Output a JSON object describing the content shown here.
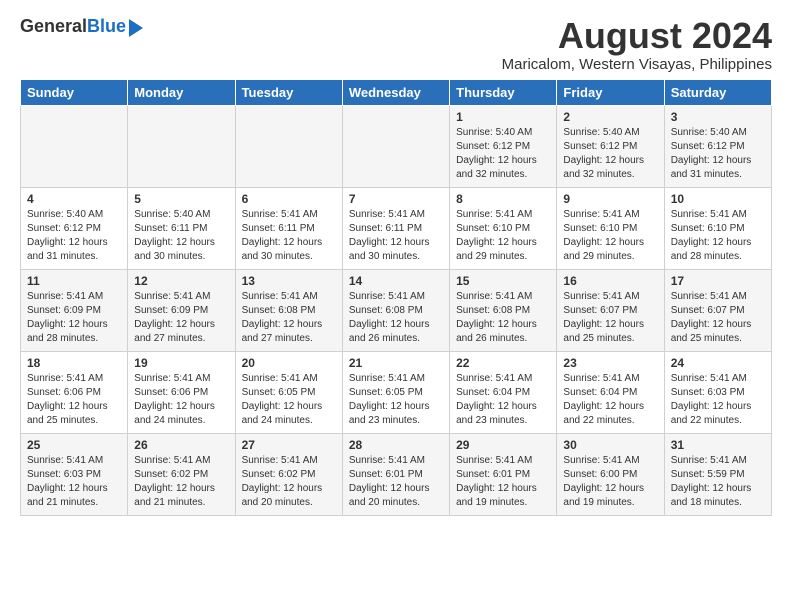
{
  "logo": {
    "general": "General",
    "blue": "Blue"
  },
  "title": {
    "month_year": "August 2024",
    "location": "Maricalom, Western Visayas, Philippines"
  },
  "headers": [
    "Sunday",
    "Monday",
    "Tuesday",
    "Wednesday",
    "Thursday",
    "Friday",
    "Saturday"
  ],
  "weeks": [
    [
      {
        "day": "",
        "sunrise": "",
        "sunset": "",
        "daylight": ""
      },
      {
        "day": "",
        "sunrise": "",
        "sunset": "",
        "daylight": ""
      },
      {
        "day": "",
        "sunrise": "",
        "sunset": "",
        "daylight": ""
      },
      {
        "day": "",
        "sunrise": "",
        "sunset": "",
        "daylight": ""
      },
      {
        "day": "1",
        "sunrise": "Sunrise: 5:40 AM",
        "sunset": "Sunset: 6:12 PM",
        "daylight": "Daylight: 12 hours and 32 minutes."
      },
      {
        "day": "2",
        "sunrise": "Sunrise: 5:40 AM",
        "sunset": "Sunset: 6:12 PM",
        "daylight": "Daylight: 12 hours and 32 minutes."
      },
      {
        "day": "3",
        "sunrise": "Sunrise: 5:40 AM",
        "sunset": "Sunset: 6:12 PM",
        "daylight": "Daylight: 12 hours and 31 minutes."
      }
    ],
    [
      {
        "day": "4",
        "sunrise": "Sunrise: 5:40 AM",
        "sunset": "Sunset: 6:12 PM",
        "daylight": "Daylight: 12 hours and 31 minutes."
      },
      {
        "day": "5",
        "sunrise": "Sunrise: 5:40 AM",
        "sunset": "Sunset: 6:11 PM",
        "daylight": "Daylight: 12 hours and 30 minutes."
      },
      {
        "day": "6",
        "sunrise": "Sunrise: 5:41 AM",
        "sunset": "Sunset: 6:11 PM",
        "daylight": "Daylight: 12 hours and 30 minutes."
      },
      {
        "day": "7",
        "sunrise": "Sunrise: 5:41 AM",
        "sunset": "Sunset: 6:11 PM",
        "daylight": "Daylight: 12 hours and 30 minutes."
      },
      {
        "day": "8",
        "sunrise": "Sunrise: 5:41 AM",
        "sunset": "Sunset: 6:10 PM",
        "daylight": "Daylight: 12 hours and 29 minutes."
      },
      {
        "day": "9",
        "sunrise": "Sunrise: 5:41 AM",
        "sunset": "Sunset: 6:10 PM",
        "daylight": "Daylight: 12 hours and 29 minutes."
      },
      {
        "day": "10",
        "sunrise": "Sunrise: 5:41 AM",
        "sunset": "Sunset: 6:10 PM",
        "daylight": "Daylight: 12 hours and 28 minutes."
      }
    ],
    [
      {
        "day": "11",
        "sunrise": "Sunrise: 5:41 AM",
        "sunset": "Sunset: 6:09 PM",
        "daylight": "Daylight: 12 hours and 28 minutes."
      },
      {
        "day": "12",
        "sunrise": "Sunrise: 5:41 AM",
        "sunset": "Sunset: 6:09 PM",
        "daylight": "Daylight: 12 hours and 27 minutes."
      },
      {
        "day": "13",
        "sunrise": "Sunrise: 5:41 AM",
        "sunset": "Sunset: 6:08 PM",
        "daylight": "Daylight: 12 hours and 27 minutes."
      },
      {
        "day": "14",
        "sunrise": "Sunrise: 5:41 AM",
        "sunset": "Sunset: 6:08 PM",
        "daylight": "Daylight: 12 hours and 26 minutes."
      },
      {
        "day": "15",
        "sunrise": "Sunrise: 5:41 AM",
        "sunset": "Sunset: 6:08 PM",
        "daylight": "Daylight: 12 hours and 26 minutes."
      },
      {
        "day": "16",
        "sunrise": "Sunrise: 5:41 AM",
        "sunset": "Sunset: 6:07 PM",
        "daylight": "Daylight: 12 hours and 25 minutes."
      },
      {
        "day": "17",
        "sunrise": "Sunrise: 5:41 AM",
        "sunset": "Sunset: 6:07 PM",
        "daylight": "Daylight: 12 hours and 25 minutes."
      }
    ],
    [
      {
        "day": "18",
        "sunrise": "Sunrise: 5:41 AM",
        "sunset": "Sunset: 6:06 PM",
        "daylight": "Daylight: 12 hours and 25 minutes."
      },
      {
        "day": "19",
        "sunrise": "Sunrise: 5:41 AM",
        "sunset": "Sunset: 6:06 PM",
        "daylight": "Daylight: 12 hours and 24 minutes."
      },
      {
        "day": "20",
        "sunrise": "Sunrise: 5:41 AM",
        "sunset": "Sunset: 6:05 PM",
        "daylight": "Daylight: 12 hours and 24 minutes."
      },
      {
        "day": "21",
        "sunrise": "Sunrise: 5:41 AM",
        "sunset": "Sunset: 6:05 PM",
        "daylight": "Daylight: 12 hours and 23 minutes."
      },
      {
        "day": "22",
        "sunrise": "Sunrise: 5:41 AM",
        "sunset": "Sunset: 6:04 PM",
        "daylight": "Daylight: 12 hours and 23 minutes."
      },
      {
        "day": "23",
        "sunrise": "Sunrise: 5:41 AM",
        "sunset": "Sunset: 6:04 PM",
        "daylight": "Daylight: 12 hours and 22 minutes."
      },
      {
        "day": "24",
        "sunrise": "Sunrise: 5:41 AM",
        "sunset": "Sunset: 6:03 PM",
        "daylight": "Daylight: 12 hours and 22 minutes."
      }
    ],
    [
      {
        "day": "25",
        "sunrise": "Sunrise: 5:41 AM",
        "sunset": "Sunset: 6:03 PM",
        "daylight": "Daylight: 12 hours and 21 minutes."
      },
      {
        "day": "26",
        "sunrise": "Sunrise: 5:41 AM",
        "sunset": "Sunset: 6:02 PM",
        "daylight": "Daylight: 12 hours and 21 minutes."
      },
      {
        "day": "27",
        "sunrise": "Sunrise: 5:41 AM",
        "sunset": "Sunset: 6:02 PM",
        "daylight": "Daylight: 12 hours and 20 minutes."
      },
      {
        "day": "28",
        "sunrise": "Sunrise: 5:41 AM",
        "sunset": "Sunset: 6:01 PM",
        "daylight": "Daylight: 12 hours and 20 minutes."
      },
      {
        "day": "29",
        "sunrise": "Sunrise: 5:41 AM",
        "sunset": "Sunset: 6:01 PM",
        "daylight": "Daylight: 12 hours and 19 minutes."
      },
      {
        "day": "30",
        "sunrise": "Sunrise: 5:41 AM",
        "sunset": "Sunset: 6:00 PM",
        "daylight": "Daylight: 12 hours and 19 minutes."
      },
      {
        "day": "31",
        "sunrise": "Sunrise: 5:41 AM",
        "sunset": "Sunset: 5:59 PM",
        "daylight": "Daylight: 12 hours and 18 minutes."
      }
    ]
  ]
}
